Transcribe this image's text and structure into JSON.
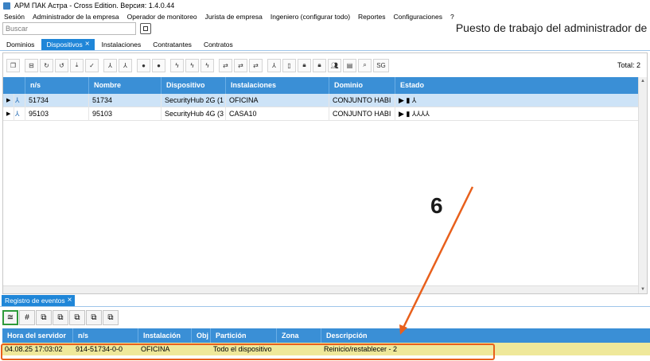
{
  "window": {
    "title": "АРМ ПАК Астра - Cross Edition. Версия: 1.4.0.44"
  },
  "menu": [
    "Sesión",
    "Administrador de la empresa",
    "Operador de monitoreo",
    "Jurista de empresa",
    "Ingeniero (configurar todo)",
    "Reportes",
    "Configuraciones",
    "?"
  ],
  "search": {
    "placeholder": "Buscar",
    "value": ""
  },
  "workspace_title": "Puesto de trabajo del administrador de e",
  "tabs": [
    {
      "label": "Dominios",
      "active": false
    },
    {
      "label": "Dispositivos",
      "active": true
    },
    {
      "label": "Instalaciones",
      "active": false
    },
    {
      "label": "Contratantes",
      "active": false
    },
    {
      "label": "Contratos",
      "active": false
    }
  ],
  "toolbar": {
    "icons": [
      "copy-icon",
      "split-icon",
      "refresh-icon",
      "timer-icon",
      "download-icon",
      "check-icon",
      "network-add-icon",
      "network-remove-icon",
      "globe-add-icon",
      "globe-remove-icon",
      "flash-add-icon",
      "flash-num-icon",
      "flash-remove-icon",
      "swap-icon",
      "swap-num-icon",
      "swap-remove-icon",
      "users-network-icon",
      "phone-icon",
      "lock-icon",
      "lock-closed-icon",
      "people-icon",
      "window-icon",
      "search-icon"
    ],
    "sg_label": "SG",
    "total_label": "Total: 2"
  },
  "devices_table": {
    "columns": [
      "n/s",
      "Nombre",
      "Dispositivo",
      "Instalaciones",
      "Dominio",
      "Estado"
    ],
    "rows": [
      {
        "ns": "51734",
        "nombre": "51734",
        "dispositivo": "SecurityHub 2G (1",
        "instalaciones": "OFICINA",
        "dominio": "CONJUNTO HABI",
        "estado": "▶ ▮ ⅄",
        "selected": true
      },
      {
        "ns": "95103",
        "nombre": "95103",
        "dispositivo": "SecurityHub 4G (3",
        "instalaciones": "CASA10",
        "dominio": "CONJUNTO HABI",
        "estado": "▶ ▮ ⅄⅄⅄⅄",
        "selected": false
      }
    ]
  },
  "events": {
    "tab_label": "Registro de eventos",
    "toolbar": [
      "≅",
      "#",
      "⧉",
      "⧉",
      "⧉",
      "⧉",
      "⧉"
    ],
    "columns": [
      "Hora del servidor",
      "n/s",
      "Instalación",
      "Obj",
      "Partición",
      "Zona",
      "Descripción"
    ],
    "rows": [
      {
        "hora": "04.08.25 17:03:02",
        "ns": "914-51734-0-0",
        "instalacion": "OFICINA",
        "obj": "",
        "particion": "Todo el dispositivo",
        "zona": "",
        "descripcion": "Reinicio/restablecer - 2"
      }
    ]
  },
  "annotation": {
    "number": "6",
    "color": "#e8601c"
  }
}
